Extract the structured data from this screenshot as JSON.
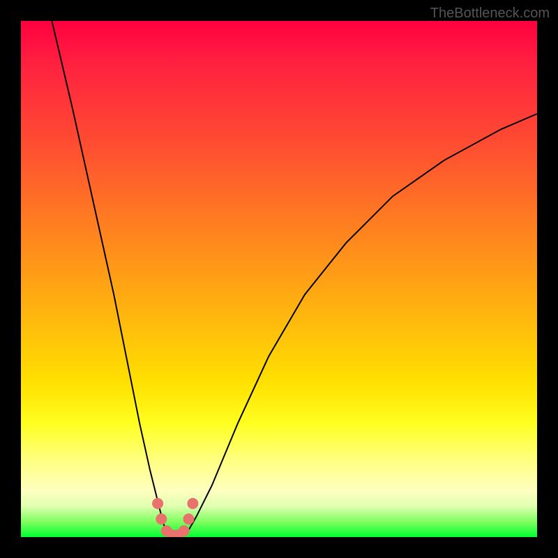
{
  "watermark": "TheBottleneck.com",
  "chart_data": {
    "type": "line",
    "title": "",
    "xlabel": "",
    "ylabel": "",
    "xlim": [
      0,
      100
    ],
    "ylim": [
      0,
      100
    ],
    "background_gradient": {
      "description": "vertical gradient red-to-green representing bottleneck severity",
      "stops": [
        {
          "pos": 0,
          "color": "#ff0040"
        },
        {
          "pos": 25,
          "color": "#ff5030"
        },
        {
          "pos": 55,
          "color": "#ffb010"
        },
        {
          "pos": 78,
          "color": "#ffff20"
        },
        {
          "pos": 100,
          "color": "#00ff30"
        }
      ]
    },
    "series": [
      {
        "name": "left-descent",
        "x": [
          6,
          10,
          14,
          18,
          21,
          23,
          25,
          26.5,
          27.5,
          28.3
        ],
        "values": [
          100,
          83,
          65,
          47,
          32,
          22,
          13,
          7,
          3,
          0.5
        ]
      },
      {
        "name": "right-ascent",
        "x": [
          32,
          34,
          37,
          42,
          48,
          55,
          63,
          72,
          82,
          93,
          100
        ],
        "values": [
          0.5,
          4,
          10,
          22,
          35,
          47,
          57,
          66,
          73,
          79,
          82
        ]
      }
    ],
    "markers": {
      "name": "trough-markers",
      "color": "#e8736d",
      "radius_px": 8,
      "points": [
        {
          "x": 26.5,
          "y": 6.5
        },
        {
          "x": 27.2,
          "y": 3.5
        },
        {
          "x": 28.2,
          "y": 1.2
        },
        {
          "x": 29.3,
          "y": 0.4
        },
        {
          "x": 30.5,
          "y": 0.4
        },
        {
          "x": 31.6,
          "y": 1.2
        },
        {
          "x": 32.5,
          "y": 3.5
        },
        {
          "x": 33.3,
          "y": 6.5
        }
      ]
    }
  }
}
